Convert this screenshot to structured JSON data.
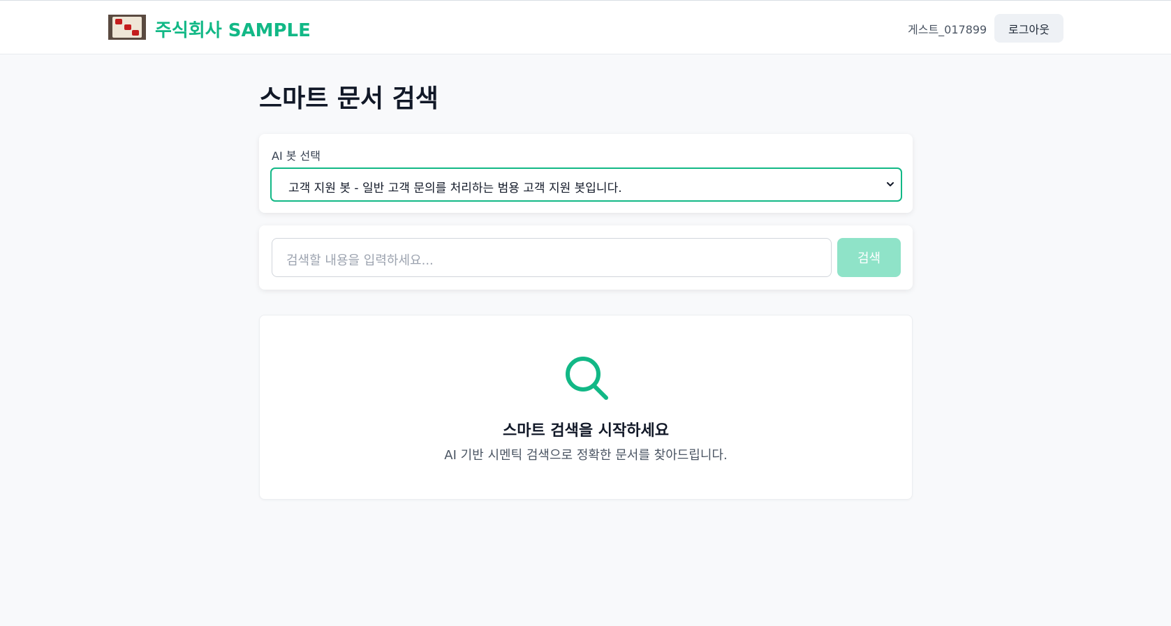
{
  "header": {
    "brand": "주식회사 SAMPLE",
    "username": "게스트_017899",
    "logout_label": "로그아웃",
    "logo_icon": "company-logo-image"
  },
  "page": {
    "title": "스마트 문서 검색"
  },
  "bot_select": {
    "label": "AI 봇 선택",
    "selected": "고객 지원 봇 - 일반 고객 문의를 처리하는 범용 고객 지원 봇입니다."
  },
  "search": {
    "placeholder": "검색할 내용을 입력하세요...",
    "button_label": "검색"
  },
  "empty_state": {
    "icon": "search-icon",
    "title": "스마트 검색을 시작하세요",
    "subtitle": "AI 기반 시멘틱 검색으로 정확한 문서를 찾아드립니다."
  },
  "colors": {
    "accent": "#12b886",
    "accent_light": "#8fe3c8",
    "background": "#f8f9fb"
  }
}
